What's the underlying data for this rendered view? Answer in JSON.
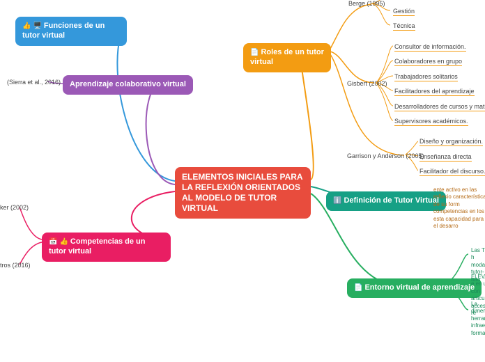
{
  "center": {
    "label": "ELEMENTOS INICIALES PARA LA REFLEXIÓN ORIENTADOS AL MODELO DE TUTOR VIRTUAL"
  },
  "left": {
    "funciones": {
      "label": "Funciones de un tutor virtual"
    },
    "aprendizaje": {
      "label": "Aprendizaje colaborativo virtual",
      "child": "(Sierra et al., 2016)"
    },
    "competencias": {
      "label": "Competencias de un tutor virtual",
      "children": [
        "ker (2002)",
        "tros (2016)"
      ]
    }
  },
  "right": {
    "roles": {
      "label": "Roles de un tutor virtual",
      "berge": {
        "label": "Berge (1995)",
        "children": [
          "Gestión",
          "Técnica"
        ]
      },
      "gisbert": {
        "label": "Gisbert (2002)",
        "children": [
          "Consultor de información.",
          "Colaboradores en grupo",
          "Trabajadores solitarios",
          "Facilitadores del aprendizaje",
          "Desarrolladores de cursos y materiales",
          "Supervisores académicos."
        ]
      },
      "garrison": {
        "label": "Garrison y Anderson (2005)",
        "children": [
          "Diseño y organización.",
          "Enseñanza directa",
          "Facilitador del discurso."
        ]
      }
    },
    "definicion": {
      "label": "Definición de Tutor Virtual",
      "text": "ente activo en las reflexio características de su form competencias en los esta capacidad para el desarro"
    },
    "entorno": {
      "label": "Entorno virtual de aprendizaje",
      "children": [
        "Las TIC h modalida tutor-tuto",
        "El EVA, e en un con articulan acceso re",
        "La dimen herramie infraestru formativa"
      ]
    }
  }
}
